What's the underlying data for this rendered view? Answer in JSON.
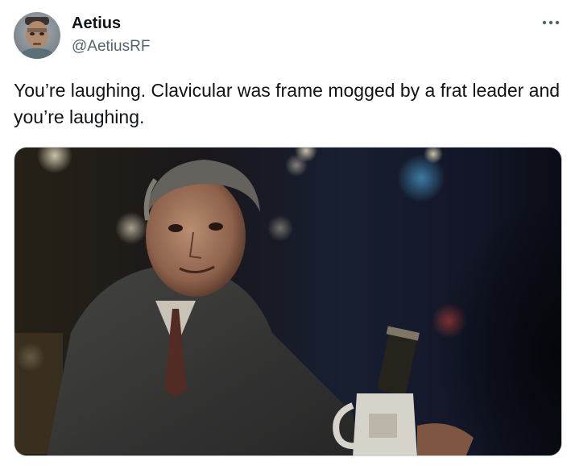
{
  "author": {
    "display_name": "Aetius",
    "handle": "@AetiusRF",
    "avatar_icon": "profile-avatar"
  },
  "more_menu": {
    "icon": "more-horizontal-icon"
  },
  "tweet": {
    "text": "You’re laughing. Clavicular was frame mogged by a frat leader and you’re laughing."
  },
  "media": {
    "type": "image",
    "description_icon": "photo"
  },
  "colors": {
    "text_primary": "#0f1419",
    "text_secondary": "#536471",
    "border": "#cfd9de"
  }
}
